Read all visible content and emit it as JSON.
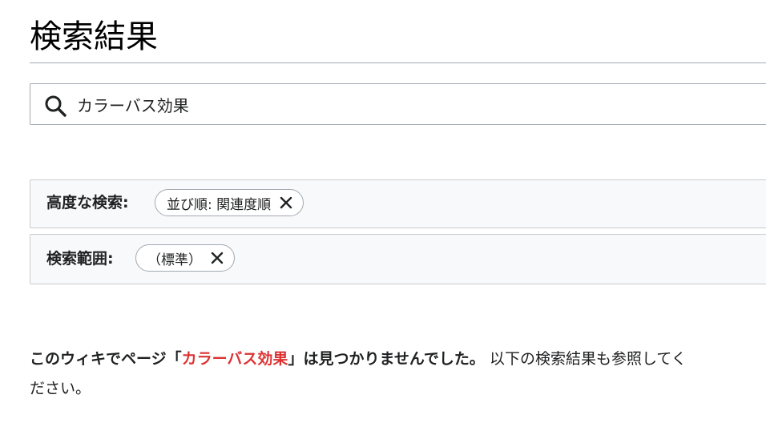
{
  "page": {
    "title": "検索結果"
  },
  "search": {
    "value": "カラーバス効果",
    "icon": "search-icon"
  },
  "filters": {
    "sort": {
      "label": "高度な検索:",
      "chip": "並び順: 関連度順",
      "remove_icon": "close-icon"
    },
    "scope": {
      "label": "検索範囲:",
      "chip": "（標準）",
      "remove_icon": "close-icon"
    }
  },
  "result_message": {
    "prefix": "このウィキでページ「",
    "link_text": "カラーバス効果",
    "suffix": "」は見つかりませんでした。",
    "trailing": " 以下の検索結果も参照してください。",
    "link_color": "#dd3333"
  }
}
